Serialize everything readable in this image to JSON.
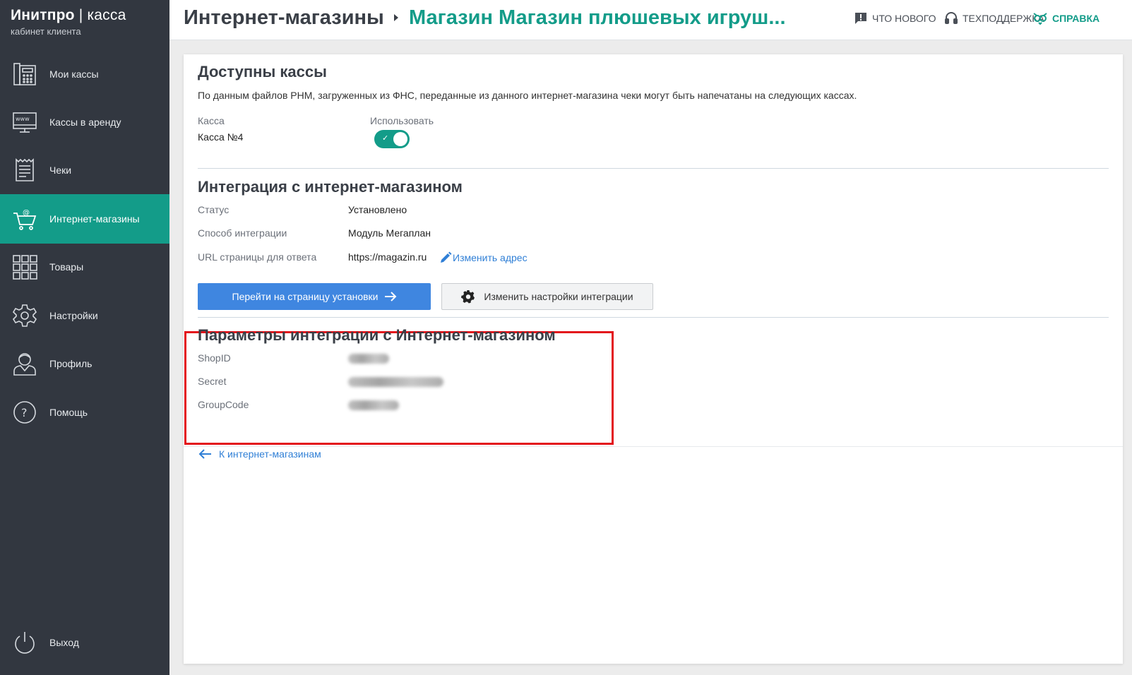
{
  "brand": {
    "name": "Инитпро",
    "separator": " | ",
    "product": "касса",
    "subtitle": "кабинет клиента"
  },
  "nav": [
    {
      "label": "Мои кассы",
      "icon": "cash-register-icon",
      "active": false
    },
    {
      "label": "Кассы в аренду",
      "icon": "www-monitor-icon",
      "active": false
    },
    {
      "label": "Чеки",
      "icon": "receipt-icon",
      "active": false
    },
    {
      "label": "Интернет-магазины",
      "icon": "shopping-cart-at-icon",
      "active": true
    },
    {
      "label": "Товары",
      "icon": "grid-icon",
      "active": false
    },
    {
      "label": "Настройки",
      "icon": "gear-icon",
      "active": false
    },
    {
      "label": "Профиль",
      "icon": "user-icon",
      "active": false
    },
    {
      "label": "Помощь",
      "icon": "question-circle-icon",
      "active": false
    }
  ],
  "logout": {
    "label": "Выход",
    "icon": "power-icon"
  },
  "header": {
    "crumb_root": "Интернет-магазины",
    "crumb_current": "Магазин Магазин плюшевых игруш...",
    "links": {
      "whats_new": "ЧТО НОВОГО",
      "support": "ТЕХПОДДЕРЖКА",
      "help": "СПРАВКА"
    }
  },
  "available": {
    "title": "Доступны кассы",
    "description": "По данным файлов РНМ, загруженных из ФНС, переданные из данного интернет-магазина чеки могут быть напечатаны на следующих кассах.",
    "col_register": "Касса",
    "col_use": "Использовать",
    "register_name": "Касса №4",
    "use_enabled": true
  },
  "integration": {
    "title": "Интеграция с интернет-магазином",
    "status_label": "Статус",
    "status_value": "Установлено",
    "method_label": "Способ интеграции",
    "method_value": "Модуль Мегаплан",
    "url_label": "URL страницы для ответа",
    "url_value": "https://magazin.ru",
    "change_url_link": "Изменить адрес",
    "install_button": "Перейти на страницу установки",
    "settings_button": "Изменить настройки интеграции"
  },
  "params": {
    "title": "Параметры интеграции с Интернет-магазином",
    "shopid_label": "ShopID",
    "secret_label": "Secret",
    "groupcode_label": "GroupCode"
  },
  "back_link": "К интернет-магазинам",
  "colors": {
    "sidebar": "#323740",
    "accent": "#139c89",
    "primary_button": "#3f86e0",
    "link": "#2f7fd6",
    "highlight": "#e3141c"
  }
}
